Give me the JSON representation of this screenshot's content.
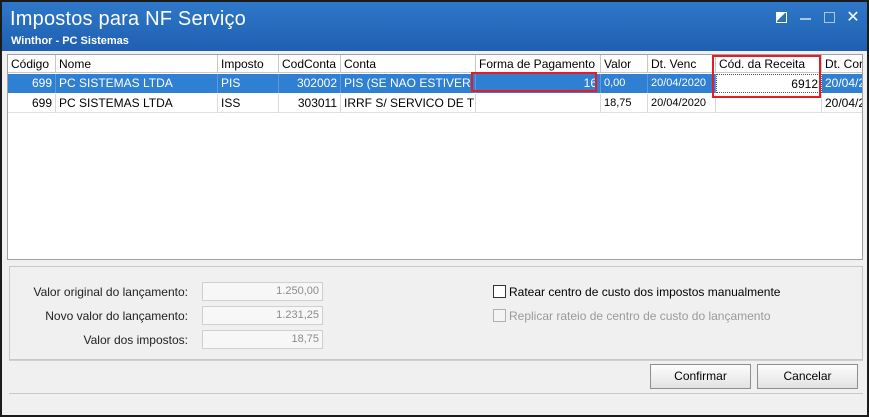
{
  "window": {
    "title": "Impostos para NF Serviço",
    "subtitle": "Winthor - PC Sistemas"
  },
  "grid": {
    "columns": [
      "Código",
      "Nome",
      "Imposto",
      "CodConta",
      "Conta",
      "Forma de Pagamento",
      "Valor",
      "Dt. Venc",
      "Cód. da Receita",
      "Dt. Cor"
    ],
    "rows": [
      {
        "codigo": "699",
        "nome": "PC SISTEMAS LTDA",
        "imposto": "PIS",
        "codconta": "302002",
        "conta": "PIS (SE NAO ESTIVER N",
        "forma_pagamento": "16",
        "valor": "0,00",
        "dt_venc": "20/04/2020",
        "cod_receita": "6912",
        "dt_cor": "20/04/2"
      },
      {
        "codigo": "699",
        "nome": "PC SISTEMAS LTDA",
        "imposto": "ISS",
        "codconta": "303011",
        "conta": "IRRF S/ SERVICO DE TE",
        "forma_pagamento": "",
        "valor": "18,75",
        "dt_venc": "20/04/2020",
        "cod_receita": "",
        "dt_cor": "20/04/2"
      }
    ]
  },
  "fields": {
    "valor_original_label": "Valor original do lançamento:",
    "valor_original": "1.250,00",
    "novo_valor_label": "Novo valor do lançamento:",
    "novo_valor": "1.231,25",
    "valor_impostos_label": "Valor dos impostos:",
    "valor_impostos": "18,75"
  },
  "options": {
    "ratear_label": "Ratear centro de custo dos impostos manualmente",
    "ratear_checked": false,
    "replicar_label": "Replicar rateio de centro de custo do lançamento",
    "replicar_checked": false,
    "replicar_enabled": false
  },
  "buttons": {
    "confirmar": "Confirmar",
    "cancelar": "Cancelar"
  },
  "colors": {
    "titlebar": "#1f5fb0",
    "selection": "#2f7fd2",
    "highlight": "#e51c23"
  }
}
